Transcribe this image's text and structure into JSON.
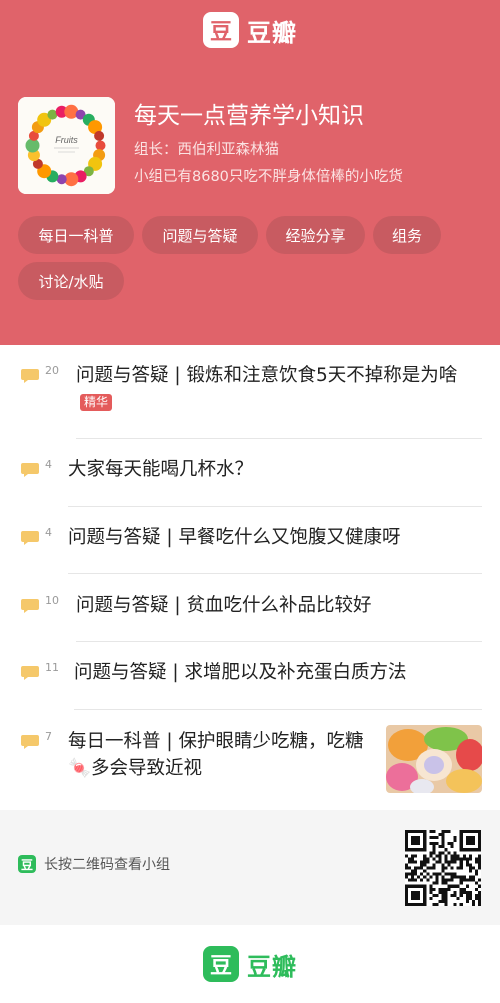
{
  "brand": {
    "logo_char": "豆",
    "name": "豆瓣"
  },
  "group": {
    "cover_label": "Fruits",
    "title": "每天一点营养学小知识",
    "owner": "组长：西伯利亚森林猫",
    "description": "小组已有8680只吃不胖身体倍棒的小吃货"
  },
  "tabs": [
    "每日一科普",
    "问题与答疑",
    "经验分享",
    "组务",
    "讨论/水贴"
  ],
  "posts": [
    {
      "count": "20",
      "title": "问题与答疑 | 锻炼和注意饮食5天不掉称是为啥",
      "badge": "精华"
    },
    {
      "count": "4",
      "title": "大家每天能喝几杯水？"
    },
    {
      "count": "4",
      "title": "问题与答疑 | 早餐吃什么又饱腹又健康呀"
    },
    {
      "count": "10",
      "title": "问题与答疑 | 贫血吃什么补品比较好"
    },
    {
      "count": "11",
      "title": "问题与答疑 | 求增肥以及补充蛋白质方法"
    },
    {
      "count": "7",
      "title": "每日一科普 | 保护眼睛少吃糖，吃糖🍬多会导致近视"
    }
  ],
  "qr": {
    "hint": "长按二维码查看小组"
  },
  "colors": {
    "header": "#e0636a",
    "tab": "#c85b61",
    "accent_green": "#2ebc5b",
    "badge": "#e45b5b",
    "bubble": "#f5c86a"
  },
  "icons": [
    "comment-bubble-icon",
    "douban-logo-icon",
    "qr-code-icon",
    "candy-emoji"
  ]
}
